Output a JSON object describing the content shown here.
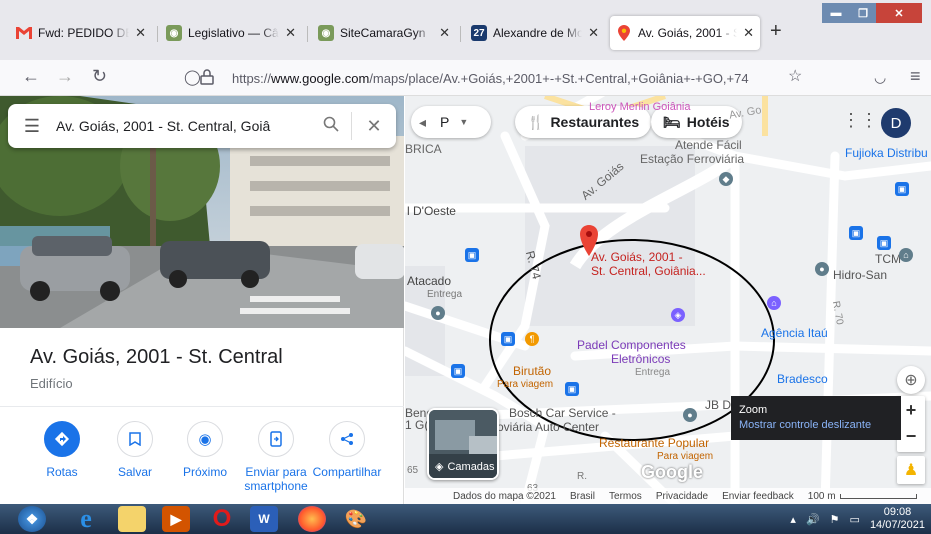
{
  "tabs": [
    {
      "title": "Fwd: PEDIDO DE E",
      "icon": "gmail-icon"
    },
    {
      "title": "Legislativo — Câm",
      "icon": "camara-icon"
    },
    {
      "title": "SiteCamaraGyn",
      "icon": "camara-icon"
    },
    {
      "title": "Alexandre de Mor",
      "icon": "calendar-icon",
      "icon_text": "27"
    },
    {
      "title": "Av. Goiás, 2001 - S",
      "icon": "maps-pin-icon",
      "active": true
    }
  ],
  "url": {
    "prefix": "https://",
    "host": "www.google.com",
    "path": "/maps/place/Av.+Goiás,+2001+-+St.+Central,+Goiânia+-+GO,+74"
  },
  "search": {
    "value": "Av. Goiás, 2001 - St. Central, Goiâ"
  },
  "place": {
    "title": "Av. Goiás, 2001 - St. Central",
    "type": "Edifício"
  },
  "actions": [
    {
      "label": "Rotas",
      "icon": "directions-icon"
    },
    {
      "label": "Salvar",
      "icon": "bookmark-icon"
    },
    {
      "label": "Próximo",
      "icon": "nearby-icon"
    },
    {
      "label": "Enviar para smartphone",
      "icon": "send-to-phone-icon"
    },
    {
      "label": "Compartilhar",
      "icon": "share-icon"
    }
  ],
  "map": {
    "chips": {
      "transport": "P",
      "restaurants": "Restaurantes",
      "hotels": "Hotéis"
    },
    "account_initial": "D",
    "pin_label": [
      "Av. Goiás, 2001 -",
      "St. Central, Goiânia..."
    ],
    "labels": {
      "leroy": "Leroy Merlin Goiânia",
      "atende": "Atende Fácil",
      "estacao": "Estação Ferroviária",
      "fujioka": "Fujioka Distribu",
      "brica": "BRICA",
      "oeste": "l D'Oeste",
      "atacado": "Atacado",
      "entrega1": "Entrega",
      "tcm": "TCM",
      "hidro": "Hidro-San",
      "agencia": "Agência Itaú",
      "padel": "Padel Componentes",
      "eletronicos": "Eletrônicos",
      "entrega2": "Entrega",
      "birutao": "Birutão",
      "paraviagem1": "Para viagem",
      "bradesco": "Bradesco",
      "bosch": "Bosch Car Service -",
      "ferroviaria": "Ferroviária Auto Center",
      "restaurante": "Restaurante Popular",
      "paraviagem2": "Para viagem",
      "jbde": "JB De",
      "r74": "R. 74",
      "r70": "R. 70",
      "avgoias": "Av. Goiás",
      "avgo": "Av. Go",
      "beno": "Beno",
      "num65": "65",
      "num63": "63",
      "rr": "R.",
      "ig": "1 G("
    },
    "layers_label": "Camadas",
    "google_logo": "Google",
    "tooltip": {
      "title": "Zoom",
      "link": "Mostrar controle deslizante"
    },
    "footer": {
      "data": "Dados do mapa ©2021",
      "country": "Brasil",
      "terms": "Termos",
      "privacy": "Privacidade",
      "feedback": "Enviar feedback",
      "scale": "100 m"
    }
  },
  "taskbar": {
    "time": "09:08",
    "date": "14/07/2021"
  },
  "colors": {
    "accent": "#1a73e8",
    "pin": "#ea4335",
    "restaurant": "#f29900"
  }
}
